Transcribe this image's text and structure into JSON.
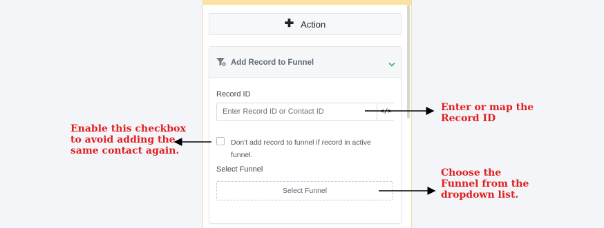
{
  "panel": {
    "action_button": {
      "icon": "plus-icon",
      "label": "Action"
    },
    "card": {
      "icon": "funnel-icon",
      "title": "Add Record to Funnel",
      "toggle_icon": "chevron-down-icon",
      "record_id": {
        "label": "Record ID",
        "placeholder": "Enter Record ID or Contact ID",
        "map_button": "</>"
      },
      "checkbox": {
        "checked": false,
        "label": "Don't add record to funnel if record in active funnel."
      },
      "select_funnel": {
        "label": "Select Funnel",
        "button": "Select Funnel"
      }
    }
  },
  "annotations": {
    "record_id_note": "Enter or map the\nRecord ID",
    "checkbox_note": "Enable this checkbox\nto avoid adding the\nsame contact again.",
    "funnel_note": "Choose the\nFunnel from the\ndropdown list."
  },
  "colors": {
    "annotation_text": "#e02020",
    "panel_top_bar": "#fde3a3",
    "chevron": "#3cb371"
  }
}
